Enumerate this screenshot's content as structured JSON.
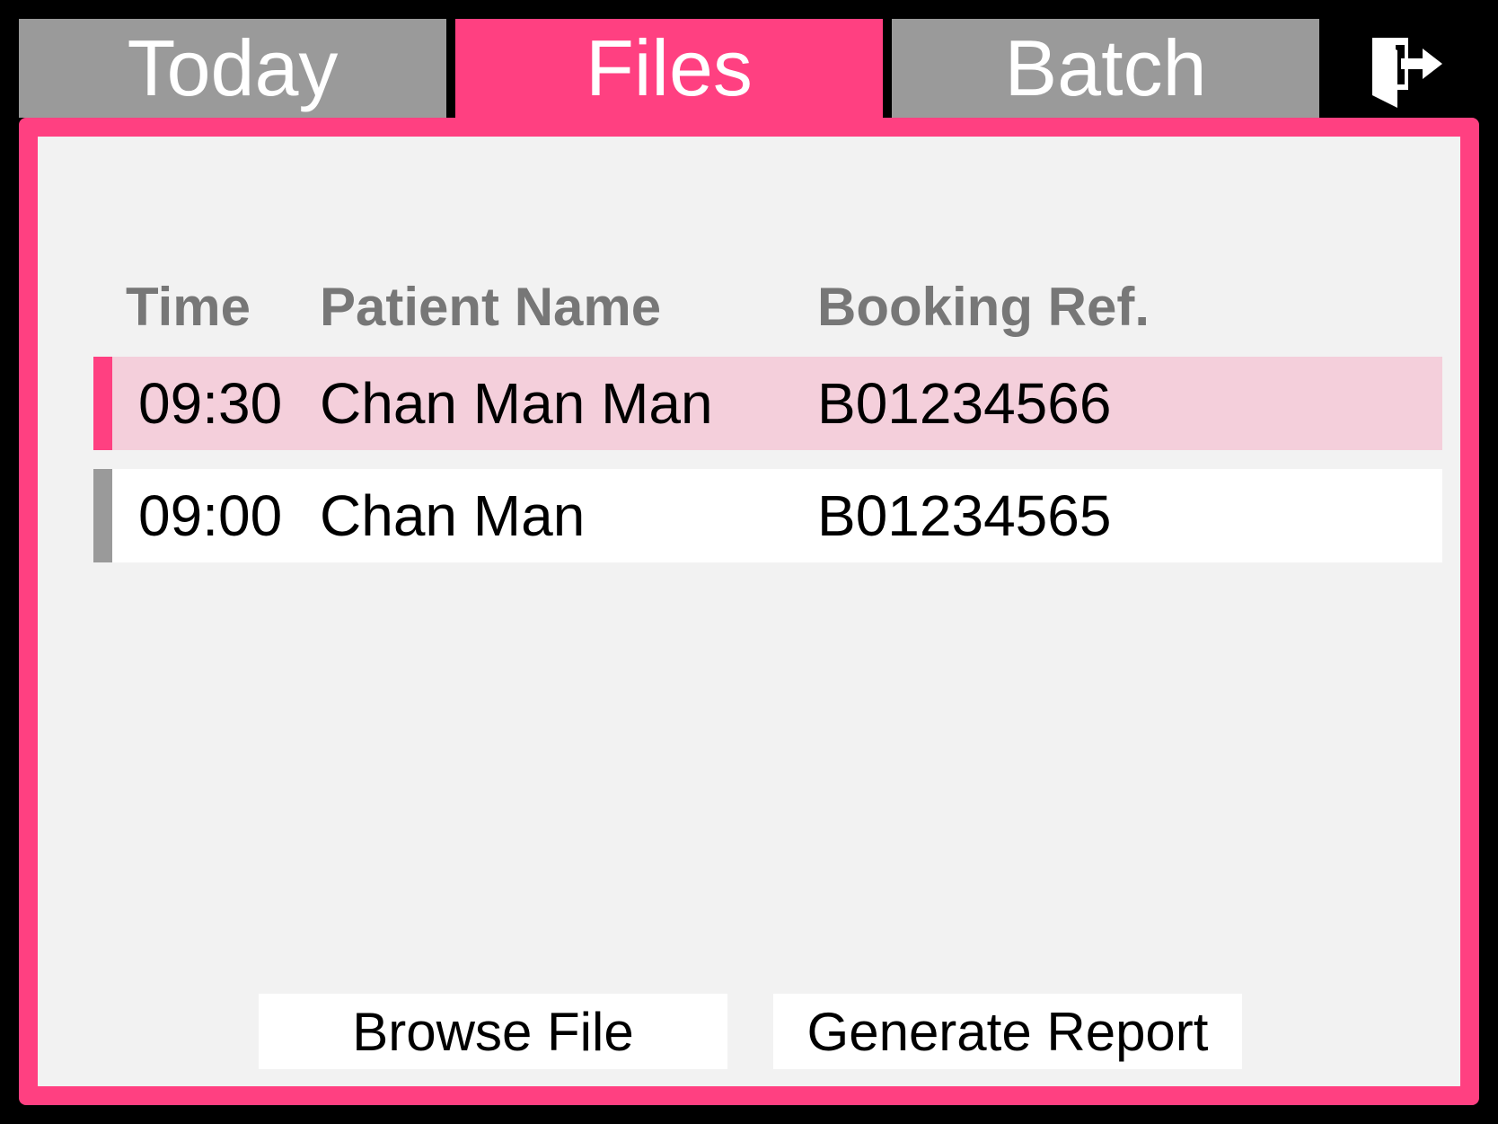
{
  "tabs": [
    {
      "label": "Today",
      "active": false
    },
    {
      "label": "Files",
      "active": true
    },
    {
      "label": "Batch",
      "active": false
    }
  ],
  "exit_icon": "exit-door-icon",
  "table": {
    "headers": [
      "Time",
      "Patient Name",
      "Booking Ref."
    ],
    "rows": [
      {
        "time": "09:30",
        "name": "Chan Man Man",
        "ref": "B01234566",
        "selected": true
      },
      {
        "time": "09:00",
        "name": "Chan Man",
        "ref": "B01234565",
        "selected": false
      }
    ]
  },
  "buttons": {
    "browse_label": "Browse File",
    "report_label": "Generate Report"
  },
  "colors": {
    "accent": "#ff4081",
    "inactive_tab": "#9a9a9a",
    "selected_row": "#f4cfdb",
    "panel": "#f2f2f2",
    "background": "#000000"
  }
}
